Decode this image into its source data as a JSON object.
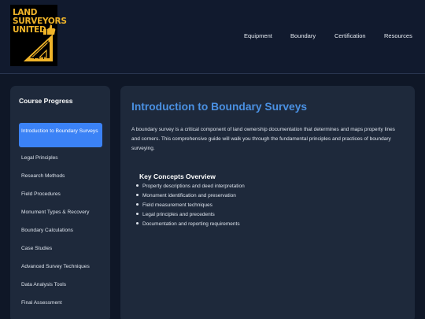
{
  "brand": {
    "line1": "LAND",
    "line2": "SURVEYORS",
    "line3": "UNITED"
  },
  "nav": [
    "Equipment",
    "Boundary",
    "Certification",
    "Resources"
  ],
  "sidebar": {
    "title": "Course Progress",
    "items": [
      "Introduction to Boundary Surveys",
      "Legal Principles",
      "Research Methods",
      "Field Procedures",
      "Monument Types & Recovery",
      "Boundary Calculations",
      "Case Studies",
      "Advanced Survey Techniques",
      "Data Analysis Tools",
      "Final Assessment"
    ],
    "active_index": 0
  },
  "main": {
    "title": "Introduction to Boundary Surveys",
    "intro": "A boundary survey is a critical component of land ownership documentation that determines and maps property lines and corners. This comprehensive guide will walk you through the fundamental principles and practices of boundary surveying.",
    "concepts_title": "Key Concepts Overview",
    "concepts": [
      "Property descriptions and deed interpretation",
      "Monument identification and preservation",
      "Field measurement techniques",
      "Legal principles and precedents",
      "Documentation and reporting requirements"
    ]
  },
  "colors": {
    "accent": "#3b82f6",
    "title_blue": "#4a90e2",
    "logo_gold": "#f0b429",
    "bg": "#0f1727",
    "panel": "#1e293b"
  },
  "icons": [
    "thumbs-up-icon",
    "triangle-ruler-icon"
  ]
}
